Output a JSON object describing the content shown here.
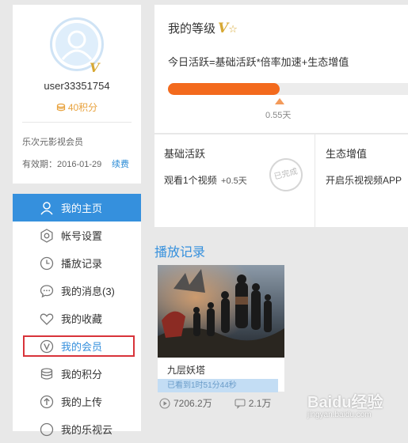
{
  "profile": {
    "username": "user33351754",
    "points": "40积分",
    "member_type": "乐次元影视会员",
    "validity": "有效期：2016-01-29",
    "renew": "续费"
  },
  "nav": {
    "items": [
      {
        "label": "我的主页",
        "icon": "user-icon",
        "active": true
      },
      {
        "label": "帐号设置",
        "icon": "gear-icon"
      },
      {
        "label": "播放记录",
        "icon": "clock-icon"
      },
      {
        "label": "我的消息(3)",
        "icon": "message-icon"
      },
      {
        "label": "我的收藏",
        "icon": "heart-icon"
      },
      {
        "label": "我的会员",
        "icon": "vip-icon",
        "highlighted": true
      },
      {
        "label": "我的积分",
        "icon": "coins-icon"
      },
      {
        "label": "我的上传",
        "icon": "upload-icon"
      },
      {
        "label": "我的乐视云",
        "icon": "cloud-icon"
      }
    ]
  },
  "level": {
    "title": "我的等级",
    "badge": "V",
    "formula": "今日活跃=基础活跃*倍率加速+生态增值",
    "progress_days": "0.55天",
    "progress_fraction": 0.45
  },
  "tasks": {
    "basic_title": "基础活跃",
    "basic_desc": "观看1个视频",
    "basic_reward": "+0.5天",
    "basic_status": "已完成",
    "eco_title": "生态增值",
    "eco_desc": "开启乐视视频APP"
  },
  "history": {
    "section_title": "播放记录",
    "video_title": "九层妖塔",
    "watched": "已看到1时51分44秒",
    "plays": "7206.2万",
    "comments": "2.1万"
  },
  "watermark": {
    "brand": "Baidu经验",
    "url": "jingyan.baidu.com"
  },
  "colors": {
    "accent": "#3590dd",
    "progress": "#f36a1d",
    "highlight_border": "#d8333a",
    "gold": "#d7a833"
  }
}
